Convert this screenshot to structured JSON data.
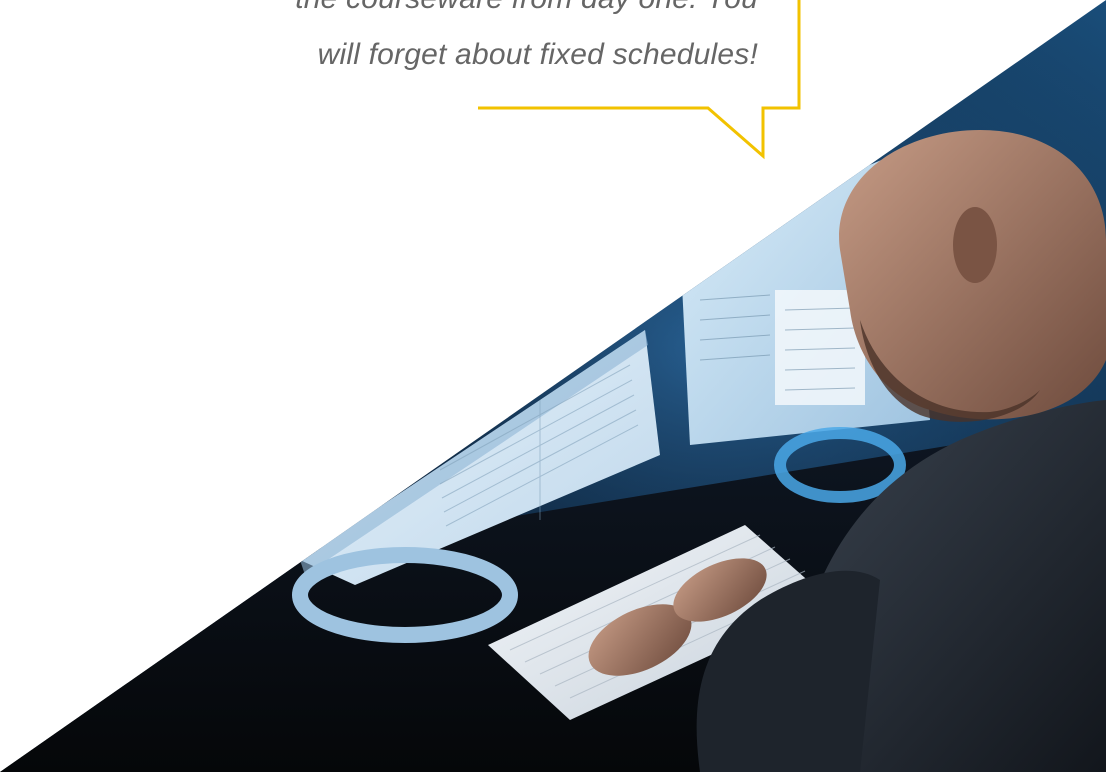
{
  "testimonial": {
    "line1": "the courseware from day one. You",
    "line2": "will forget about fixed schedules!"
  },
  "colors": {
    "accent": "#f2c200",
    "background": "#ffffff",
    "quote_text": "#666666"
  },
  "photo": {
    "subject": "person typing on a keyboard in front of monitors"
  }
}
